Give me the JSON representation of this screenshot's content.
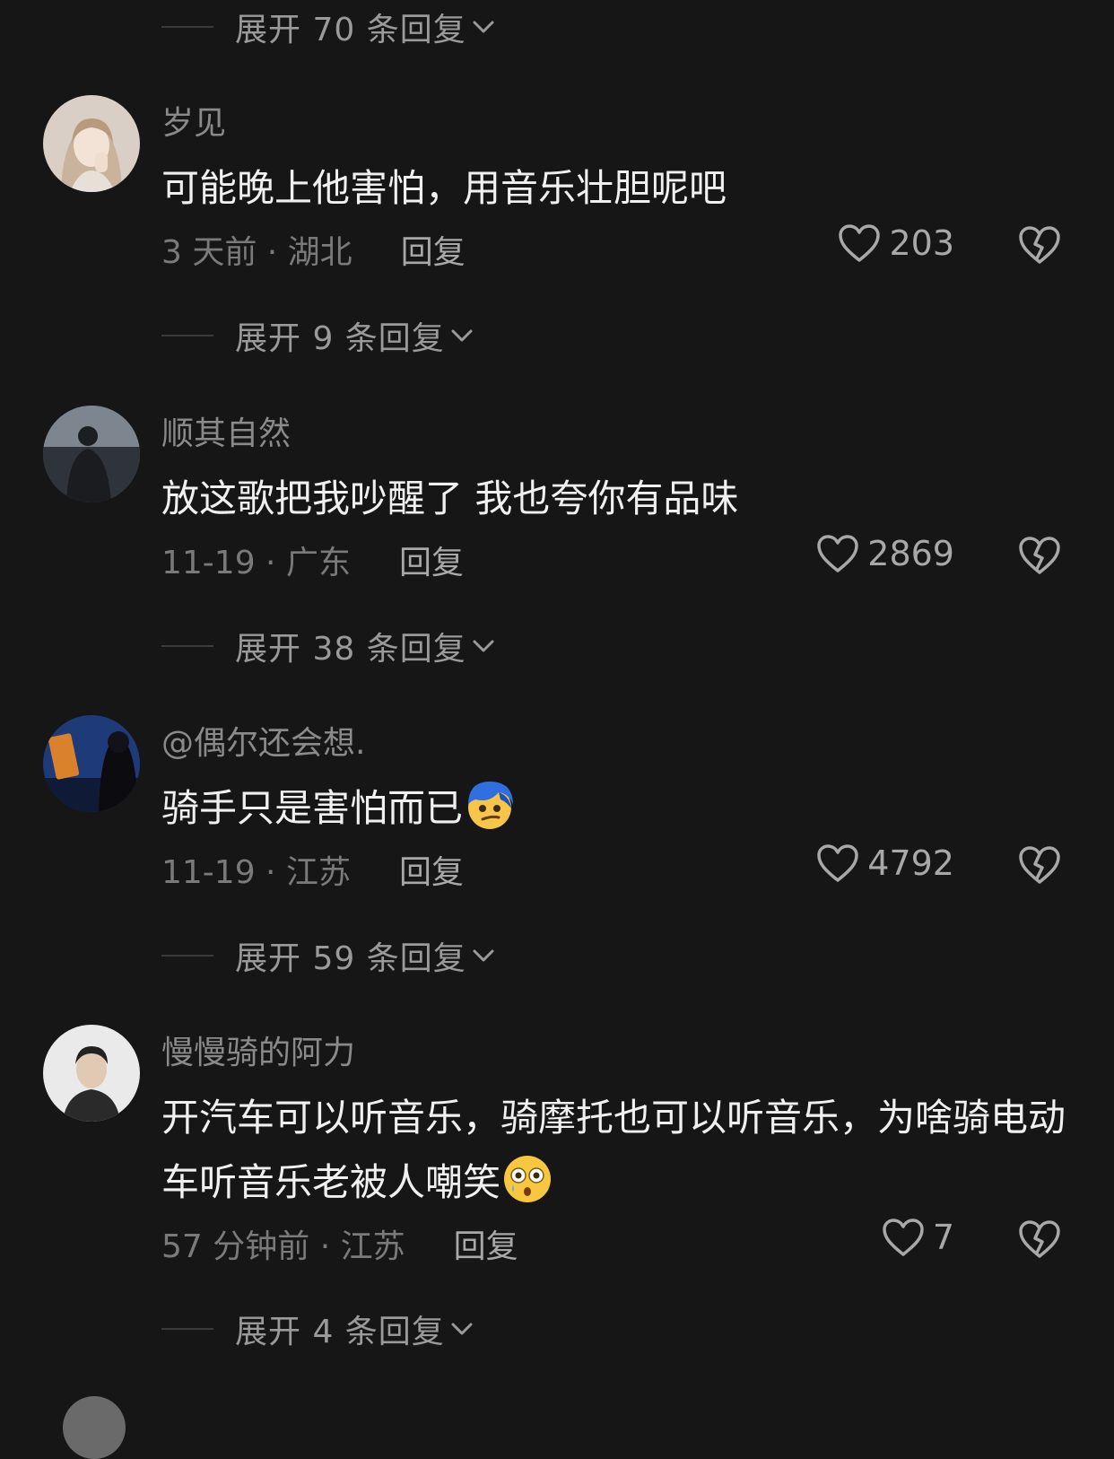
{
  "expand_top": "展开 70 条回复",
  "comments": [
    {
      "username": "岁见",
      "text": "可能晚上他害怕，用音乐壮胆呢吧",
      "meta": "3 天前 · 湖北",
      "reply": "回复",
      "likes": "203",
      "expand": "展开 9 条回复"
    },
    {
      "username": "顺其自然",
      "text": "放这歌把我吵醒了 我也夸你有品味",
      "meta": "11-19 · 广东",
      "reply": "回复",
      "likes": "2869",
      "expand": "展开 38 条回复"
    },
    {
      "username": "@偶尔还会想.",
      "text": "骑手只是害怕而已",
      "emoji": "blue-hair-smirk-emoji",
      "meta": "11-19 · 江苏",
      "reply": "回复",
      "likes": "4792",
      "expand": "展开 59 条回复"
    },
    {
      "username": "慢慢骑的阿力",
      "text": "开汽车可以听音乐，骑摩托也可以听音乐，为啥骑电动车听音乐老被人嘲笑",
      "emoji": "flushed-teary-emoji",
      "meta": "57 分钟前 · 江苏",
      "reply": "回复",
      "likes": "7",
      "expand": "展开 4 条回复"
    }
  ],
  "colors": {
    "background": "#161616",
    "text": "#f0f0f0",
    "muted": "#8a8a8a"
  }
}
